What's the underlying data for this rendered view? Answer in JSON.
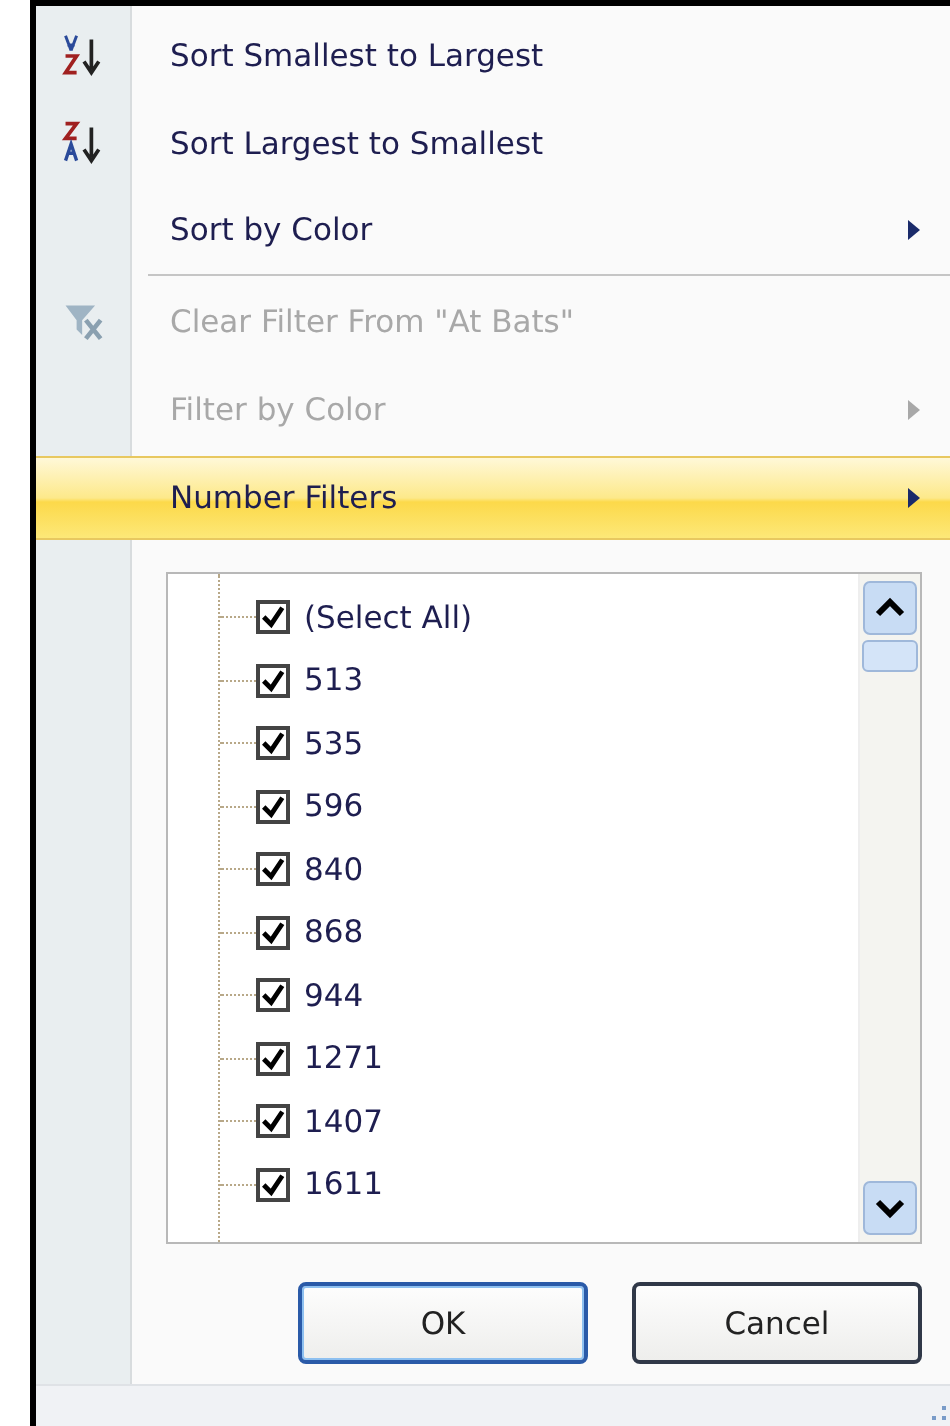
{
  "menu_items": [
    {
      "kind": "ascending",
      "label": "Sort Smallest to Largest",
      "disabled": false,
      "highlighted": false,
      "submenu": false
    },
    {
      "kind": "descending",
      "label": "Sort Largest to Smallest",
      "disabled": false,
      "highlighted": false,
      "submenu": false
    },
    {
      "kind": "plain",
      "label": "Sort by Color",
      "disabled": false,
      "highlighted": false,
      "submenu": true
    },
    {
      "kind": "separator"
    },
    {
      "kind": "clearfilter",
      "label": "Clear Filter From \"At Bats\"",
      "disabled": true,
      "highlighted": false,
      "submenu": false
    },
    {
      "kind": "plain",
      "label": "Filter by Color",
      "disabled": true,
      "highlighted": false,
      "submenu": true
    },
    {
      "kind": "plain",
      "label": "Number Filters",
      "disabled": false,
      "highlighted": true,
      "submenu": true
    }
  ],
  "values": [
    {
      "label": "(Select All)",
      "checked": true
    },
    {
      "label": "513",
      "checked": true
    },
    {
      "label": "535",
      "checked": true
    },
    {
      "label": "596",
      "checked": true
    },
    {
      "label": "840",
      "checked": true
    },
    {
      "label": "868",
      "checked": true
    },
    {
      "label": "944",
      "checked": true
    },
    {
      "label": "1271",
      "checked": true
    },
    {
      "label": "1407",
      "checked": true
    },
    {
      "label": "1611",
      "checked": true
    }
  ],
  "buttons": [
    "OK",
    "Cancel"
  ]
}
